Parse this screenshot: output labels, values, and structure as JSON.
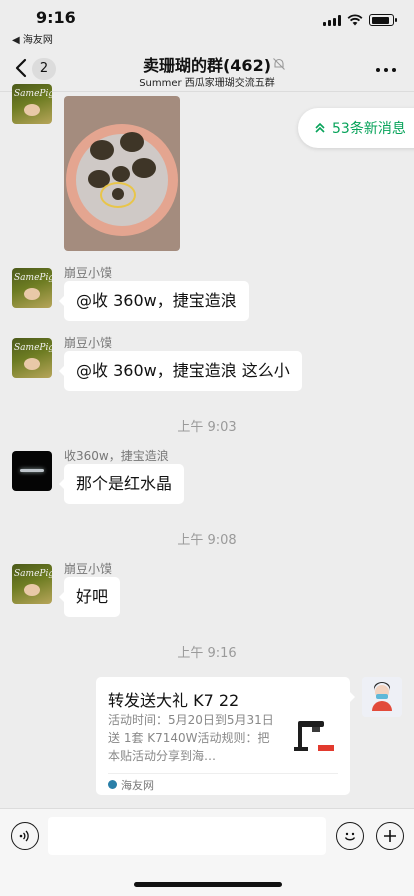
{
  "status": {
    "time": "9:16",
    "back_app": "◀ 海友网",
    "battery_level": 0.85
  },
  "header": {
    "unread_badge": "2",
    "title": "卖珊瑚的群(462)",
    "subtitle": "Summer 西瓜家珊瑚交流五群"
  },
  "new_messages": {
    "label": "53条新消息",
    "color": "#07a35a"
  },
  "messages": [
    {
      "type": "image",
      "sender": "",
      "avatar": "pig-avatar"
    },
    {
      "type": "text",
      "sender": "崩豆小馍",
      "text": "@收 360w，捷宝造浪",
      "avatar": "pig-avatar"
    },
    {
      "type": "text",
      "sender": "崩豆小馍",
      "text": "@收 360w，捷宝造浪 这么小",
      "avatar": "pig-avatar"
    },
    {
      "type": "time",
      "text": "上午 9:03"
    },
    {
      "type": "text",
      "sender": "收360w，捷宝造浪",
      "text": "那个是红水晶",
      "avatar": "dark-avatar"
    },
    {
      "type": "time",
      "text": "上午 9:08"
    },
    {
      "type": "text",
      "sender": "崩豆小馍",
      "text": "好吧",
      "avatar": "pig-avatar"
    },
    {
      "type": "time",
      "text": "上午 9:16"
    },
    {
      "type": "card",
      "title": "转发送大礼 K7 22",
      "description": "活动时间：5月20日到5月31日送 1套 K7140W活动规则：把本贴活动分享到海…",
      "source": "海友网"
    }
  ],
  "avatar_labels": {
    "pig": "SamePig"
  },
  "colors": {
    "background": "#ededed",
    "bubble": "#ffffff",
    "accent_green": "#07a35a"
  }
}
